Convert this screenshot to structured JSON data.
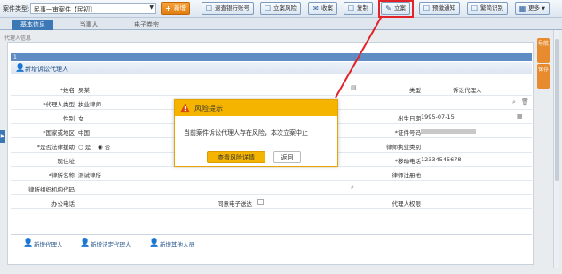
{
  "topbar": {
    "case_type_label": "案件类型:",
    "case_type_value": "民事一审案件【民初】",
    "buttons": [
      {
        "label": "新增",
        "icon": "plus-icon"
      },
      {
        "label": "退查银行账号",
        "icon": "query-icon"
      },
      {
        "label": "立案风险",
        "icon": "risk-icon"
      },
      {
        "label": "收案",
        "icon": "receive-icon"
      },
      {
        "label": "复制",
        "icon": "copy-icon"
      },
      {
        "label": "立案",
        "icon": "file-case-icon"
      },
      {
        "label": "预缴通知",
        "icon": "notice-icon"
      },
      {
        "label": "繁简识别",
        "icon": "identify-icon"
      },
      {
        "label": "更多",
        "icon": "grid-icon"
      }
    ]
  },
  "tabs": [
    "基本信息",
    "当事人",
    "电子卷宗"
  ],
  "breadcrumb": "代理人信息",
  "section": {
    "number": "1",
    "title": "新增诉讼代理人"
  },
  "form": {
    "name_label": "*姓名",
    "name_value": "吴某",
    "type_label": "类型",
    "type_value": "诉讼代理人",
    "agent_type_label": "*代理人类型",
    "agent_type_value": "执业律师",
    "gender_label": "性别",
    "gender_value": "女",
    "birth_label": "出生日期",
    "birth_value": "1995-07-15",
    "country_label": "*国家或地区",
    "country_value": "中国",
    "id_label": "*证件号码",
    "id_value": "",
    "legal_aid_label": "*是否法律援助",
    "legal_aid_yes": "是",
    "legal_aid_no": "否",
    "license_type_label": "律师执业类别",
    "address_label": "现住址",
    "mobile_label": "*移动电话",
    "mobile_value": "12334545678",
    "firm_label": "*律所名称",
    "firm_value": "测试律所",
    "firm_reg_label": "律师注册地",
    "firm_code_label": "律所组织机构代码",
    "office_phone_label": "办公电话",
    "e_service_label": "同意电子送达",
    "proxy_auth_label": "代理人权限"
  },
  "bottom_actions": [
    "新增代理人",
    "新增法定代理人",
    "新增其他人员"
  ],
  "side_buttons": [
    "导航",
    "保存"
  ],
  "modal": {
    "title": "风险提示",
    "message": "当前案件诉讼代理人存在风险，本次立案中止",
    "primary_button": "查看风险详情",
    "back_button": "返回"
  },
  "colors": {
    "accent_orange": "#f5b400",
    "highlight_red": "#e2232a",
    "primary_blue": "#3c78b5"
  }
}
